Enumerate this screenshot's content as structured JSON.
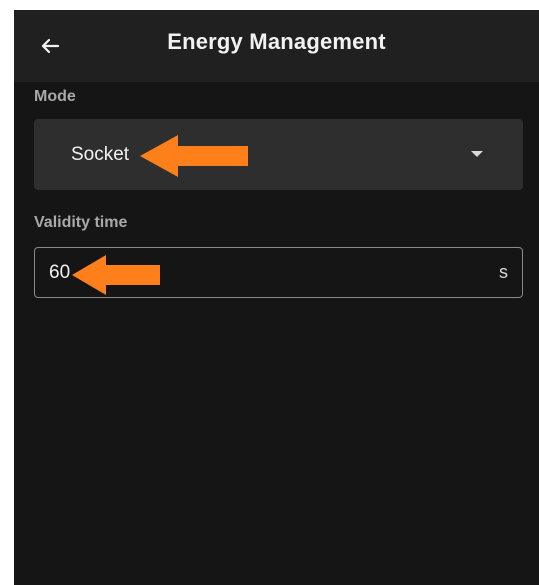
{
  "app_bar": {
    "title": "Energy Management",
    "back_icon": "arrow-left-icon"
  },
  "mode": {
    "label": "Mode",
    "selected": "Socket",
    "dropdown_icon": "caret-down-icon"
  },
  "validity": {
    "label": "Validity time",
    "value": "60",
    "unit": "s"
  },
  "colors": {
    "background": "#151515",
    "app_bar": "#202020",
    "select_bg": "#2e2e2e",
    "annotation_arrow": "#ff7f1a"
  }
}
